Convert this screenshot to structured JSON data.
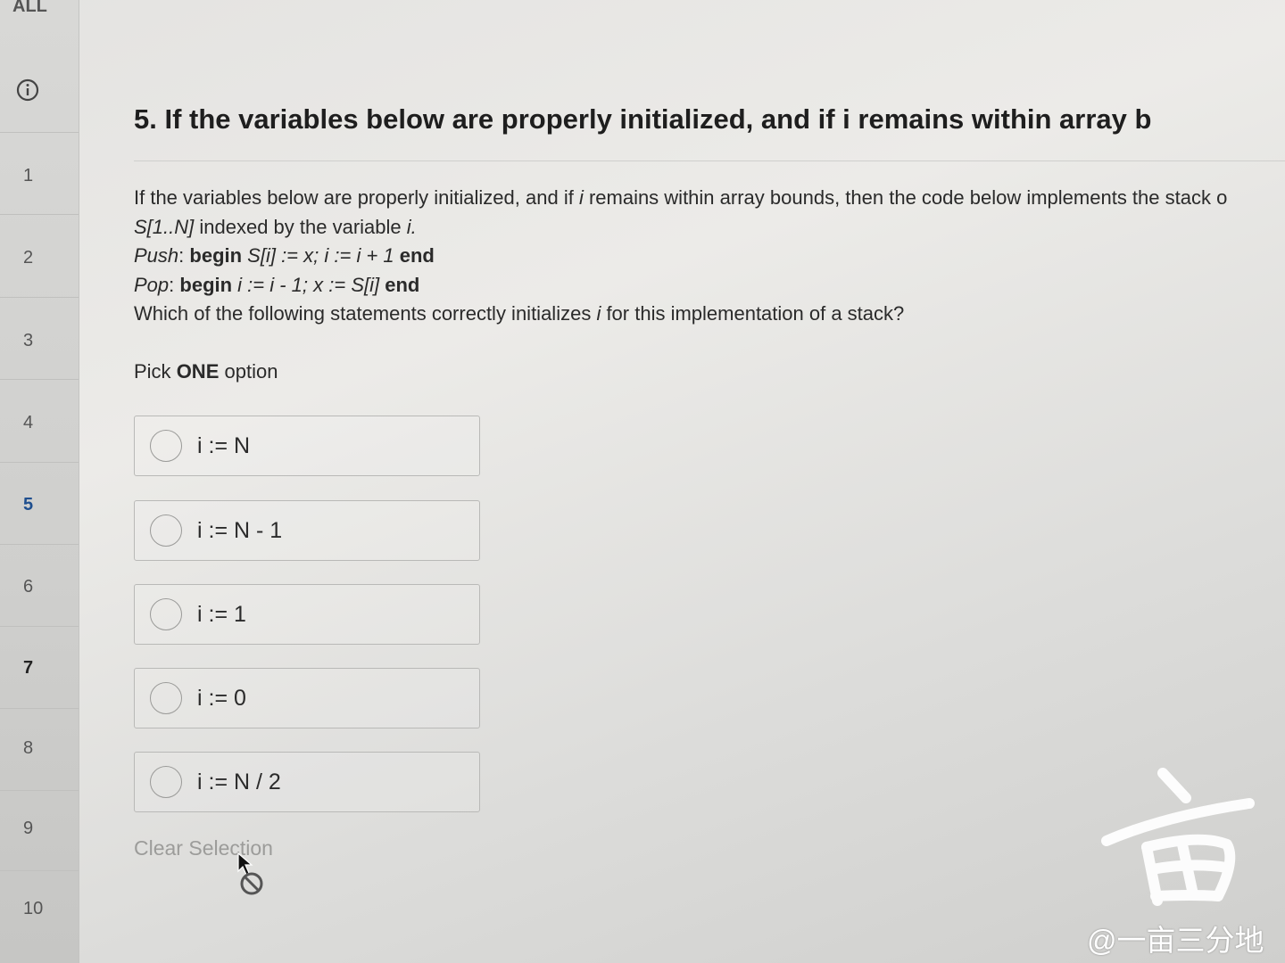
{
  "sidebar": {
    "all_label": "ALL",
    "info_icon": "info-icon",
    "items": [
      {
        "label": "1"
      },
      {
        "label": "2"
      },
      {
        "label": "3"
      },
      {
        "label": "4"
      },
      {
        "label": "5"
      },
      {
        "label": "6"
      },
      {
        "label": "7"
      },
      {
        "label": "8"
      },
      {
        "label": "9"
      },
      {
        "label": "10"
      }
    ],
    "current_item": "5"
  },
  "question": {
    "title": "5. If the variables below are properly initialized, and if i remains within array b",
    "line1_a": "If the variables below are properly initialized, and if ",
    "line1_var": "i",
    "line1_b": " remains within array bounds, then the code below implements the stack o",
    "line2_sig": "S[1..N]",
    "line2_text": " indexed by the variable ",
    "line2_var": "i.",
    "push_label": "Push",
    "push_colon": ": ",
    "push_begin": "begin",
    "push_code": " S[i] := x; i := i + 1 ",
    "push_end": "end",
    "pop_label": "Pop",
    "pop_colon": ": ",
    "pop_begin": "begin",
    "pop_code": " i := i - 1; x := S[i] ",
    "pop_end": "end",
    "prompt_a": "Which of the following statements correctly initializes ",
    "prompt_var": "i",
    "prompt_b": " for this implementation of a stack?",
    "pick_prefix": "Pick ",
    "pick_bold": "ONE",
    "pick_suffix": " option"
  },
  "options": [
    {
      "label": "i := N"
    },
    {
      "label": "i := N - 1"
    },
    {
      "label": "i := 1"
    },
    {
      "label": "i := 0"
    },
    {
      "label": "i := N / 2"
    }
  ],
  "clear_selection_label": "Clear Selection",
  "watermark": {
    "text": "@一亩三分地"
  },
  "colors": {
    "current_nav": "#1f4f8f",
    "option_border": "#b9b9b7",
    "clear_text": "#9c9c9a"
  }
}
